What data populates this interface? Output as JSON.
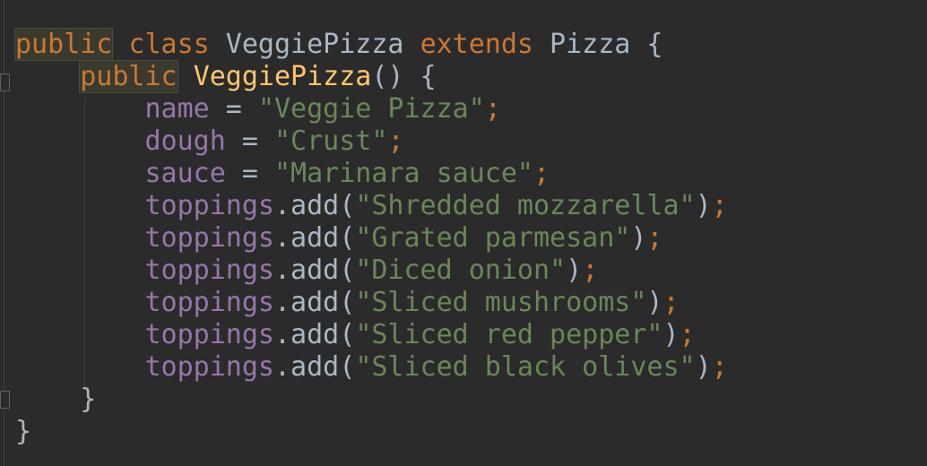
{
  "editor": {
    "lines": [
      {
        "indent": "",
        "tokens": [
          {
            "t": "public",
            "c": "kw-hl"
          },
          {
            "t": " ",
            "c": "plain"
          },
          {
            "t": "class",
            "c": "kw"
          },
          {
            "t": " VeggiePizza ",
            "c": "plain"
          },
          {
            "t": "extends",
            "c": "kw"
          },
          {
            "t": " Pizza {",
            "c": "plain"
          }
        ]
      },
      {
        "indent": "    ",
        "tokens": [
          {
            "t": "public",
            "c": "kw-hl"
          },
          {
            "t": " ",
            "c": "plain"
          },
          {
            "t": "VeggiePizza",
            "c": "fn"
          },
          {
            "t": "() {",
            "c": "plain"
          }
        ]
      },
      {
        "indent": "        ",
        "tokens": [
          {
            "t": "name",
            "c": "field"
          },
          {
            "t": " = ",
            "c": "plain"
          },
          {
            "t": "\"Veggie Pizza\"",
            "c": "str"
          },
          {
            "t": ";",
            "c": "semi"
          }
        ]
      },
      {
        "indent": "        ",
        "tokens": [
          {
            "t": "dough",
            "c": "field"
          },
          {
            "t": " = ",
            "c": "plain"
          },
          {
            "t": "\"Crust\"",
            "c": "str"
          },
          {
            "t": ";",
            "c": "semi"
          }
        ]
      },
      {
        "indent": "        ",
        "tokens": [
          {
            "t": "sauce",
            "c": "field"
          },
          {
            "t": " = ",
            "c": "plain"
          },
          {
            "t": "\"Marinara sauce\"",
            "c": "str"
          },
          {
            "t": ";",
            "c": "semi"
          }
        ]
      },
      {
        "indent": "        ",
        "tokens": [
          {
            "t": "toppings",
            "c": "field"
          },
          {
            "t": ".add(",
            "c": "plain"
          },
          {
            "t": "\"Shredded mozzarella\"",
            "c": "str"
          },
          {
            "t": ")",
            "c": "plain"
          },
          {
            "t": ";",
            "c": "semi"
          }
        ]
      },
      {
        "indent": "        ",
        "tokens": [
          {
            "t": "toppings",
            "c": "field"
          },
          {
            "t": ".add(",
            "c": "plain"
          },
          {
            "t": "\"Grated parmesan\"",
            "c": "str"
          },
          {
            "t": ")",
            "c": "plain"
          },
          {
            "t": ";",
            "c": "semi"
          }
        ]
      },
      {
        "indent": "        ",
        "tokens": [
          {
            "t": "toppings",
            "c": "field"
          },
          {
            "t": ".add(",
            "c": "plain"
          },
          {
            "t": "\"Diced onion\"",
            "c": "str"
          },
          {
            "t": ")",
            "c": "plain"
          },
          {
            "t": ";",
            "c": "semi"
          }
        ]
      },
      {
        "indent": "        ",
        "tokens": [
          {
            "t": "toppings",
            "c": "field"
          },
          {
            "t": ".add(",
            "c": "plain"
          },
          {
            "t": "\"Sliced mushrooms\"",
            "c": "str"
          },
          {
            "t": ")",
            "c": "plain"
          },
          {
            "t": ";",
            "c": "semi"
          }
        ]
      },
      {
        "indent": "        ",
        "tokens": [
          {
            "t": "toppings",
            "c": "field"
          },
          {
            "t": ".add(",
            "c": "plain"
          },
          {
            "t": "\"Sliced red pepper\"",
            "c": "str"
          },
          {
            "t": ")",
            "c": "plain"
          },
          {
            "t": ";",
            "c": "semi"
          }
        ]
      },
      {
        "indent": "        ",
        "tokens": [
          {
            "t": "toppings",
            "c": "field"
          },
          {
            "t": ".add(",
            "c": "plain"
          },
          {
            "t": "\"Sliced black olives\"",
            "c": "str"
          },
          {
            "t": ")",
            "c": "plain"
          },
          {
            "t": ";",
            "c": "semi"
          }
        ]
      },
      {
        "indent": "    ",
        "tokens": [
          {
            "t": "}",
            "c": "plain"
          }
        ]
      },
      {
        "indent": "",
        "tokens": [
          {
            "t": "}",
            "c": "plain"
          }
        ]
      }
    ]
  },
  "colors": {
    "background": "#2b2b2b",
    "keyword": "#cc7832",
    "method": "#ffc66d",
    "field": "#9876aa",
    "string": "#6a8759",
    "plain": "#a9b7c6"
  },
  "icons": [
    "fold-marker-icon"
  ]
}
